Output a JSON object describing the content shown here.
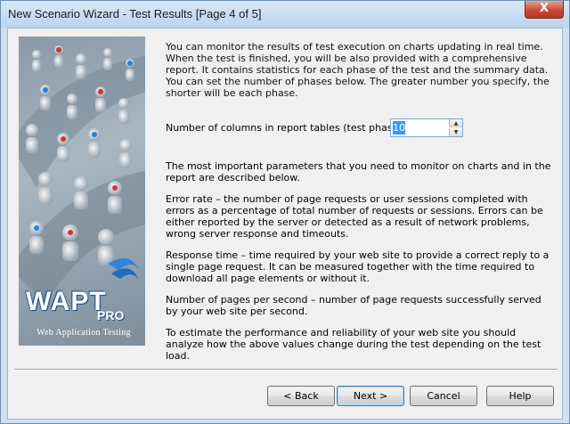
{
  "window": {
    "title": "New Scenario Wizard - Test Results [Page 4 of 5]",
    "close_label": "X"
  },
  "banner": {
    "logo": "WAPT",
    "logo_suffix": "PRO",
    "tagline": "Web Application Testing"
  },
  "intro": "You can monitor the results of test execution on charts updating in real time. When the test is finished, you will be also provided with a comprehensive report. It contains statistics for each phase of the test and the summary data. You can set the number of phases below. The greater number you specify, the shorter will be each phase.",
  "phases": {
    "label": "Number of columns in report tables (test phases):",
    "value": "10"
  },
  "description": {
    "lead": "The most important parameters that you need to monitor on charts and in the report are described below.",
    "items": [
      {
        "term": "Error rate",
        "text": " – the number of page requests or user sessions completed with errors as a percentage of total number of requests or sessions. Errors can be either reported by the server or detected as a result of network problems, wrong server response and timeouts."
      },
      {
        "term": "Response time",
        "text": " – time required by your web site to provide a correct reply to a single page request. It can be measured together with the time required to download all page elements or without it."
      },
      {
        "term": "Number of pages per second",
        "text": " – number of page requests successfully served by your web site per second."
      }
    ],
    "closing": "To estimate the performance and reliability of your web site you should analyze how the above values change during the test depending on the test load."
  },
  "buttons": {
    "back": "< Back",
    "next": "Next >",
    "cancel": "Cancel",
    "help": "Help"
  }
}
